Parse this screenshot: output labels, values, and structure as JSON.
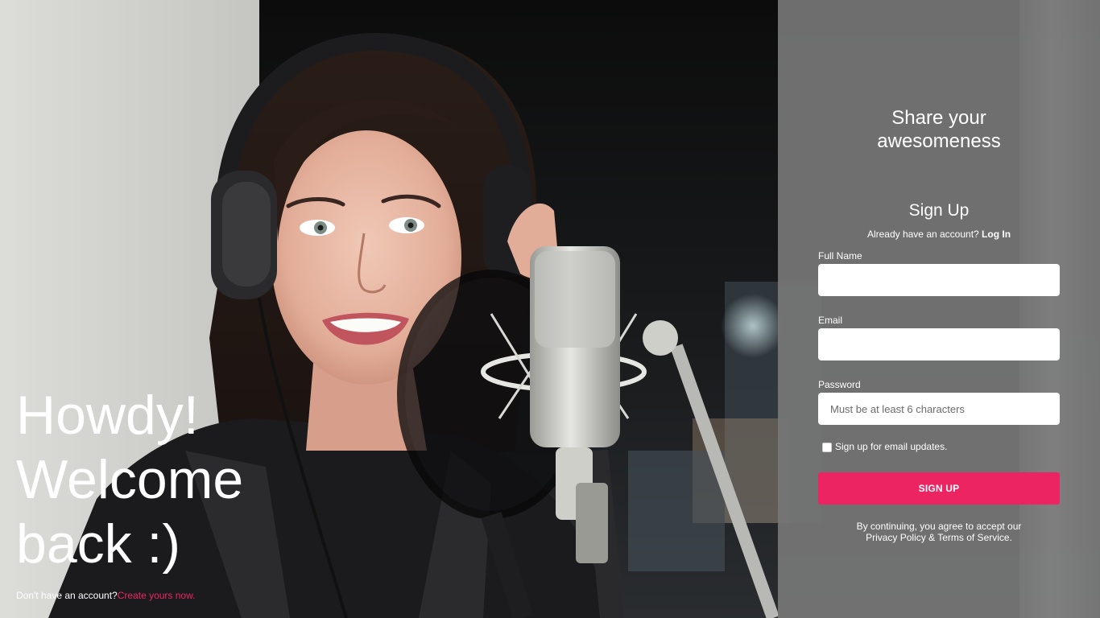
{
  "hero": {
    "greeting_lines": [
      "Howdy!",
      "Welcome",
      "back :)"
    ],
    "no_account_text": "Don't have an account?",
    "create_link": "Create yours now."
  },
  "panel": {
    "tagline_lines": [
      "Share your",
      "awesomeness"
    ],
    "title": "Sign Up",
    "already_text": "Already have an account?",
    "login_link": "Log In",
    "fields": {
      "full_name": {
        "label": "Full Name",
        "value": "",
        "placeholder": ""
      },
      "email": {
        "label": "Email",
        "value": "",
        "placeholder": ""
      },
      "password": {
        "label": "Password",
        "value": "",
        "placeholder": "Must be at least 6 characters"
      }
    },
    "checkbox_label": "Sign up for email updates.",
    "checkbox_checked": false,
    "submit_label": "SIGN UP",
    "terms_lines": [
      "By continuing, you agree to accept our",
      "Privacy Policy & Terms of Service."
    ]
  },
  "colors": {
    "accent": "#ec2462",
    "panel_bg": "#767676",
    "text": "#ffffff"
  }
}
